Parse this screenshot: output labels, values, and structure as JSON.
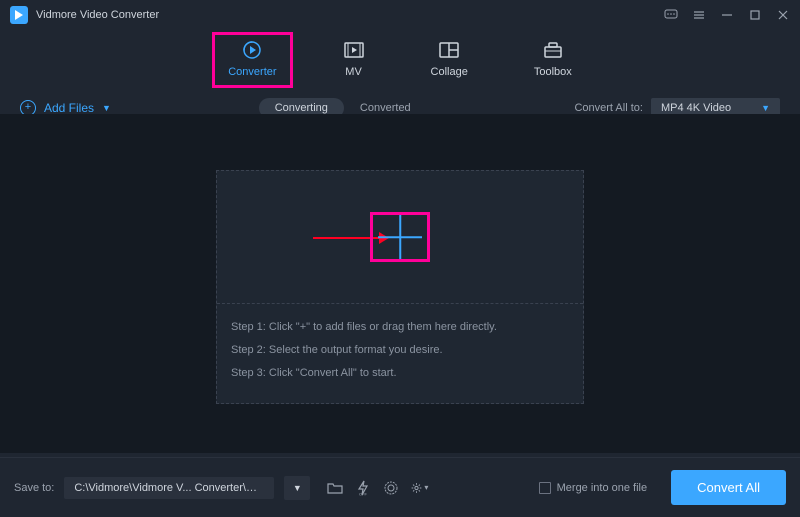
{
  "app": {
    "title": "Vidmore Video Converter"
  },
  "tabs": {
    "converter": "Converter",
    "mv": "MV",
    "collage": "Collage",
    "toolbox": "Toolbox"
  },
  "subbar": {
    "add_files": "Add Files",
    "converting": "Converting",
    "converted": "Converted",
    "convert_all_to": "Convert All to:",
    "format_selected": "MP4 4K Video"
  },
  "dropzone": {
    "step1": "Step 1: Click \"+\" to add files or drag them here directly.",
    "step2": "Step 2: Select the output format you desire.",
    "step3": "Step 3: Click \"Convert All\" to start."
  },
  "bottom": {
    "save_to": "Save to:",
    "path": "C:\\Vidmore\\Vidmore V... Converter\\Converted",
    "merge": "Merge into one file",
    "convert_all": "Convert All"
  }
}
